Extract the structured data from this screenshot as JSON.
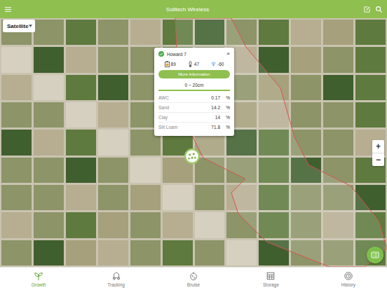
{
  "app_bar": {
    "title": "Soiltech Wireless"
  },
  "map": {
    "layer_select": "Satellite",
    "zoom_in": "+",
    "zoom_out": "−"
  },
  "popup": {
    "title": "Howard 7",
    "status_ok": true,
    "close": "×",
    "stats": [
      {
        "kind": "battery",
        "value": "89"
      },
      {
        "kind": "temperature",
        "value": "47"
      },
      {
        "kind": "signal",
        "value": "-60"
      }
    ],
    "button": "More Information",
    "depth_tab": {
      "label": "0 ~ 20cm",
      "selected": true
    },
    "rows": [
      {
        "label": "AWC",
        "value": "0.17",
        "unit": "%"
      },
      {
        "label": "Sand",
        "value": "14.2",
        "unit": "%"
      },
      {
        "label": "Clay",
        "value": "14",
        "unit": "%"
      },
      {
        "label": "Silt Loam",
        "value": "71.8",
        "unit": "%"
      }
    ]
  },
  "nav": [
    {
      "label": "Growth",
      "kind": "growth",
      "selected": true
    },
    {
      "label": "Tracking",
      "kind": "tracking",
      "selected": false
    },
    {
      "label": "Bruise",
      "kind": "bruise",
      "selected": false
    },
    {
      "label": "Storage",
      "kind": "storage",
      "selected": false
    },
    {
      "label": "History",
      "kind": "history",
      "selected": false
    }
  ]
}
